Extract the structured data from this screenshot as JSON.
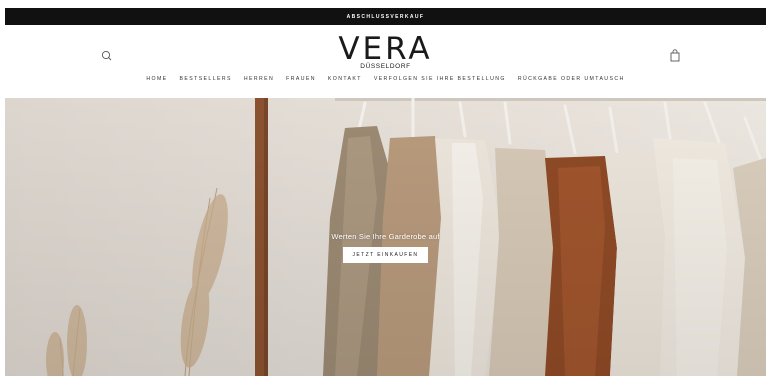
{
  "announcement": {
    "text": "ABSCHLUSSVERKAUF"
  },
  "header": {
    "logo_main": "VERA",
    "logo_sub": "DÜSSELDORF",
    "search_icon": "search-icon",
    "cart_icon": "shopping-bag-icon"
  },
  "nav": {
    "items": [
      {
        "label": "HOME"
      },
      {
        "label": "BESTSELLERS"
      },
      {
        "label": "HERREN"
      },
      {
        "label": "FRAUEN"
      },
      {
        "label": "KONTAKT"
      },
      {
        "label": "VERFOLGEN SIE IHRE BESTELLUNG"
      },
      {
        "label": "RÜCKGABE ODER UMTAUSCH"
      }
    ]
  },
  "hero": {
    "heading": "Werten Sie Ihre Garderobe auf",
    "cta_label": "JETZT EINKAUFEN"
  },
  "colors": {
    "announcement_bg": "#111111",
    "background": "#ffffff",
    "text": "#1a1a1a"
  }
}
